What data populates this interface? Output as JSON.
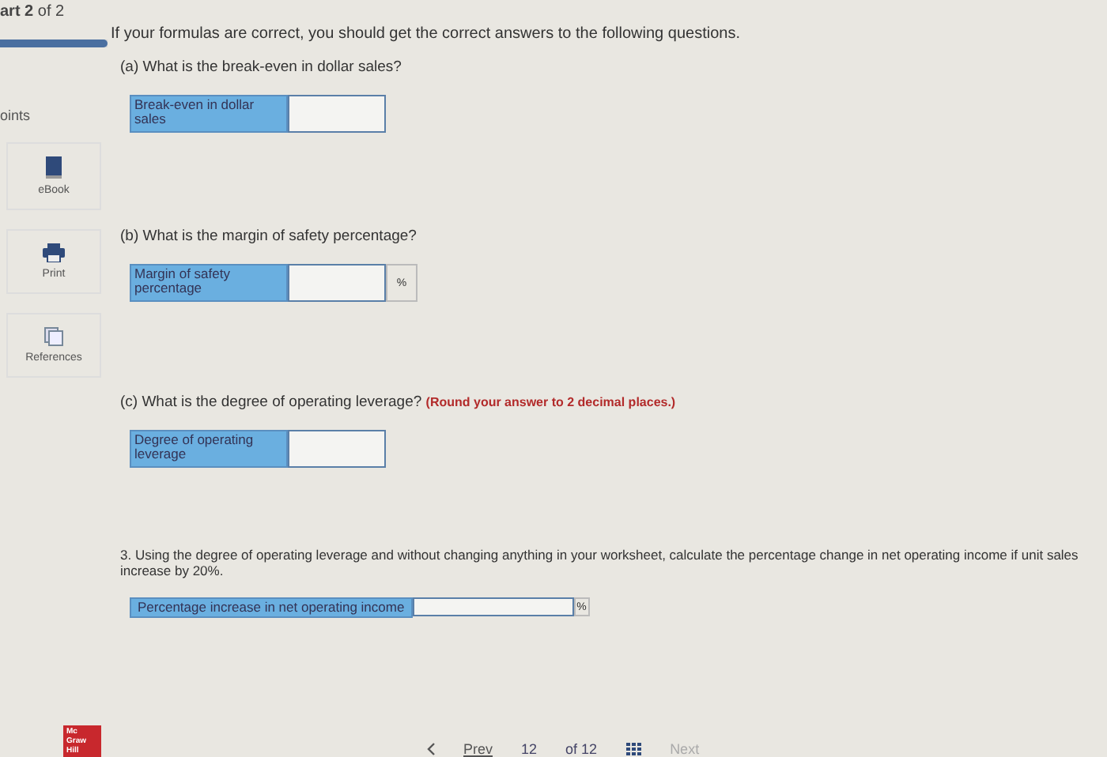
{
  "header": {
    "part": "art 2",
    "of": "of 2",
    "level": 1
  },
  "sidebar": {
    "points": "oints",
    "tools": [
      {
        "kind": "book",
        "label": "eBook"
      },
      {
        "kind": "printer",
        "label": "Print"
      },
      {
        "kind": "pages",
        "label": "References"
      }
    ]
  },
  "intro": "If your formulas are correct, you should get the correct answers to the following questions.",
  "questions": [
    {
      "prompt": "(a) What is the break-even in dollar sales?",
      "answers": [
        {
          "kind": "boxed",
          "label": "Break-even in dollar sales"
        }
      ]
    },
    {
      "prompt": "(b) What is the margin of safety percentage?",
      "answers": [
        {
          "kind": "boxed",
          "label": "Margin of safety percentage",
          "unit": "%"
        }
      ]
    },
    {
      "prompt": "(c) What is the degree of operating leverage? **(Round your answer to 2 decimal places.)**",
      "answers": [
        {
          "kind": "boxed",
          "label": "Degree of operating leverage"
        }
      ]
    },
    {
      "prompt": "3. Using the degree of operating leverage and without changing anything in your worksheet, calculate the percentage change in net operating income if unit sales increase by 20%.",
      "answers": [
        {
          "kind": "inline",
          "label": "Percentage increase in net operating income",
          "unit": "%"
        }
      ]
    }
  ],
  "logo": [
    "Mc",
    "Graw",
    "Hill"
  ],
  "footer": {
    "prev": "Prev",
    "page": "12",
    "total": "of 12",
    "next": "Next",
    "next_disabled": true
  }
}
